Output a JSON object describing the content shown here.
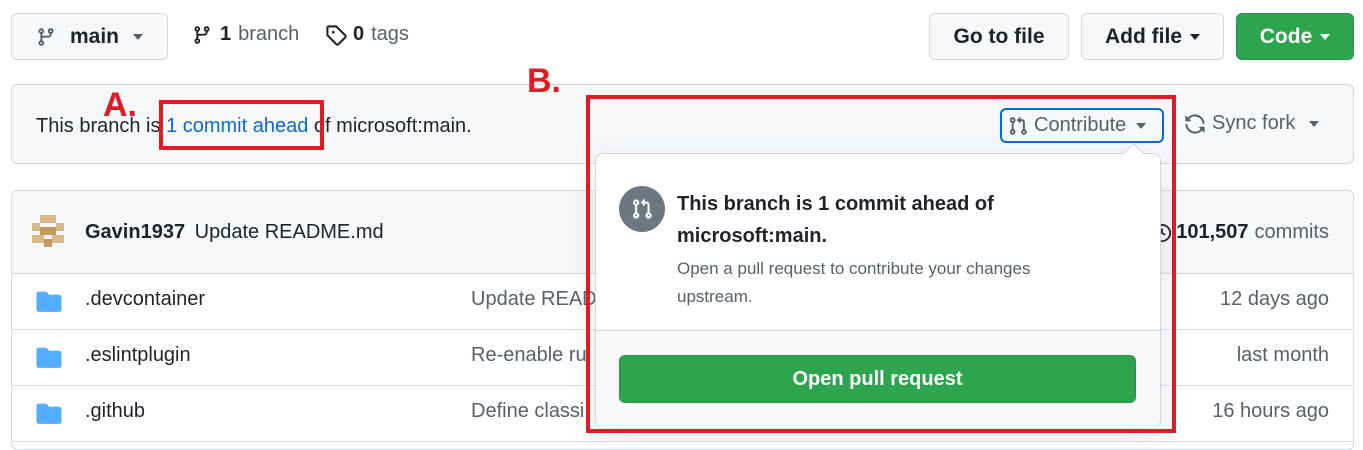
{
  "toolbar": {
    "branch_select": "main",
    "branches_count": "1",
    "branches_label": "branch",
    "tags_count": "0",
    "tags_label": "tags",
    "go_to_file": "Go to file",
    "add_file": "Add file",
    "code": "Code"
  },
  "banner": {
    "prefix": "This branch is ",
    "ahead_link": "1 commit ahead",
    "suffix": " of microsoft:main.",
    "contribute": "Contribute",
    "sync_fork": "Sync fork"
  },
  "latest_commit": {
    "author": "Gavin1937",
    "message": "Update README.md",
    "count": "101,507",
    "count_label": "commits"
  },
  "files": [
    {
      "name": ".devcontainer",
      "message": "Update READ",
      "age": "12 days ago"
    },
    {
      "name": ".eslintplugin",
      "message": "Re-enable ru",
      "age": "last month"
    },
    {
      "name": ".github",
      "message": "Define classi",
      "age": "16 hours ago"
    }
  ],
  "popup": {
    "title_line1": "This branch is 1 commit ahead of",
    "title_line2": "microsoft:main.",
    "desc_line1": "Open a pull request to contribute your changes",
    "desc_line2": "upstream.",
    "button": "Open pull request"
  },
  "annotations": {
    "a": "A.",
    "b": "B."
  },
  "colors": {
    "primary_green": "#2da44e",
    "link_blue": "#0969da",
    "annotation_red": "#e01b24",
    "folder_blue": "#54aeff"
  }
}
